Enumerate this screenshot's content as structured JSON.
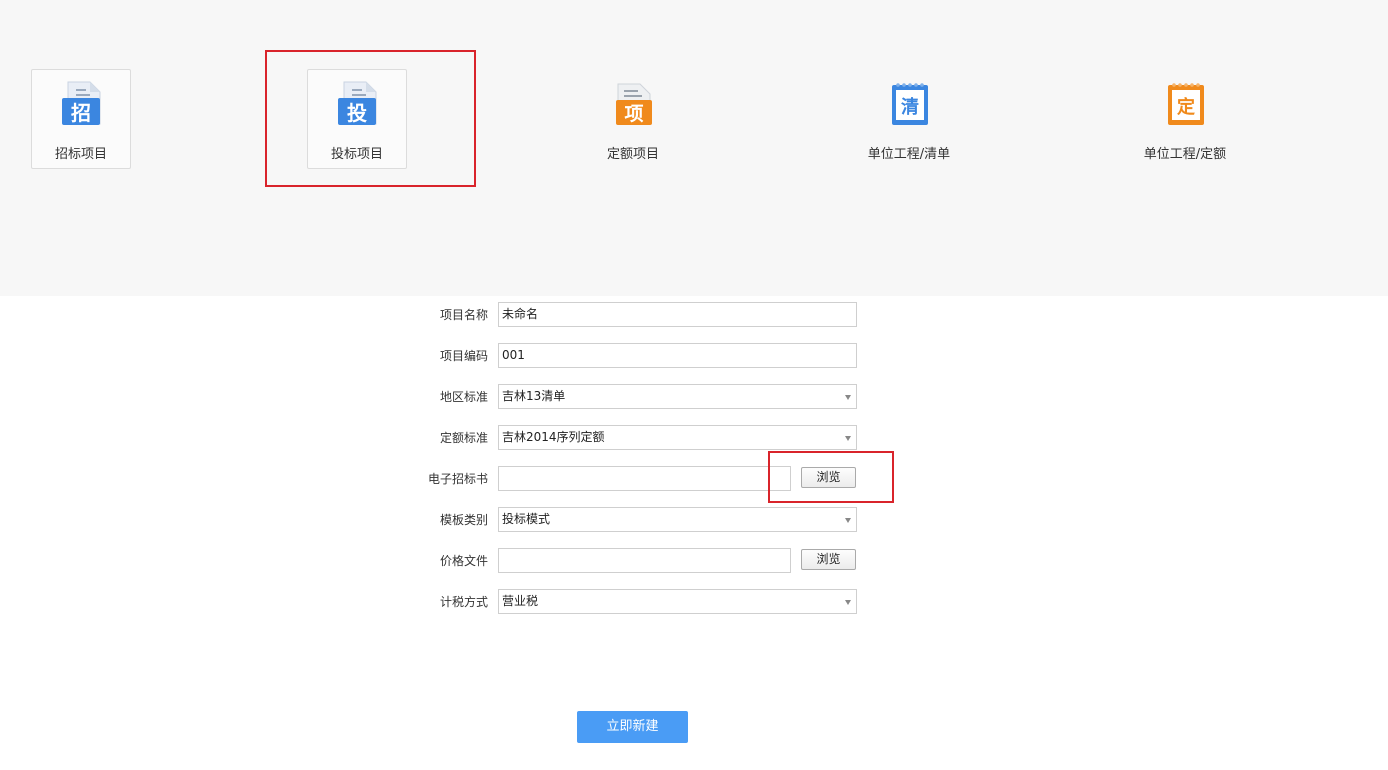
{
  "project_types": [
    {
      "label": "招标项目",
      "glyph": "招",
      "color": "#3b86e0"
    },
    {
      "label": "投标项目",
      "glyph": "投",
      "color": "#3b86e0"
    },
    {
      "label": "定额项目",
      "glyph": "项",
      "color": "#f08a1c"
    },
    {
      "label": "单位工程/清单",
      "glyph": "清",
      "color": "#3b86e0"
    },
    {
      "label": "单位工程/定额",
      "glyph": "定",
      "color": "#f08a1c"
    }
  ],
  "selected_type": "投标项目",
  "form": {
    "project_name": {
      "label": "项目名称",
      "value": "未命名"
    },
    "project_code": {
      "label": "项目编码",
      "value": "001"
    },
    "region_standard": {
      "label": "地区标准",
      "value": "吉林13清单"
    },
    "quota_standard": {
      "label": "定额标准",
      "value": "吉林2014序列定额"
    },
    "e_tender_doc": {
      "label": "电子招标书",
      "value": "",
      "button": "浏览"
    },
    "template_type": {
      "label": "模板类别",
      "value": "投标模式"
    },
    "price_file": {
      "label": "价格文件",
      "value": "",
      "button": "浏览"
    },
    "tax_method": {
      "label": "计税方式",
      "value": "营业税"
    }
  },
  "submit_label": "立即新建",
  "colors": {
    "highlight": "#d9242b",
    "primary": "#4a9cf5"
  }
}
